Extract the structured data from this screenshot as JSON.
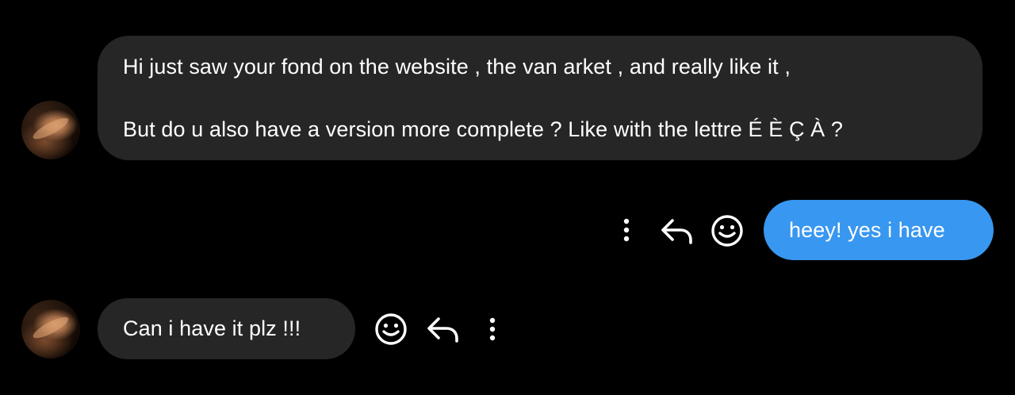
{
  "thread": {
    "messages": [
      {
        "sender": "them",
        "lines": [
          "Hi just saw your fond on the website , the van arket , and really like it ,",
          "But do u also have a version more complete ? Like with the lettre É È Ç À ?"
        ]
      },
      {
        "sender": "me",
        "text": "heey! yes i have"
      },
      {
        "sender": "them",
        "text": "Can i have it plz !!!"
      }
    ]
  },
  "colors": {
    "background": "#000000",
    "incoming_bubble": "#262626",
    "outgoing_bubble": "#3897f0",
    "text": "#ffffff"
  },
  "icons": {
    "message_actions": [
      "more-options-icon",
      "reply-icon",
      "emoji-react-icon"
    ]
  }
}
